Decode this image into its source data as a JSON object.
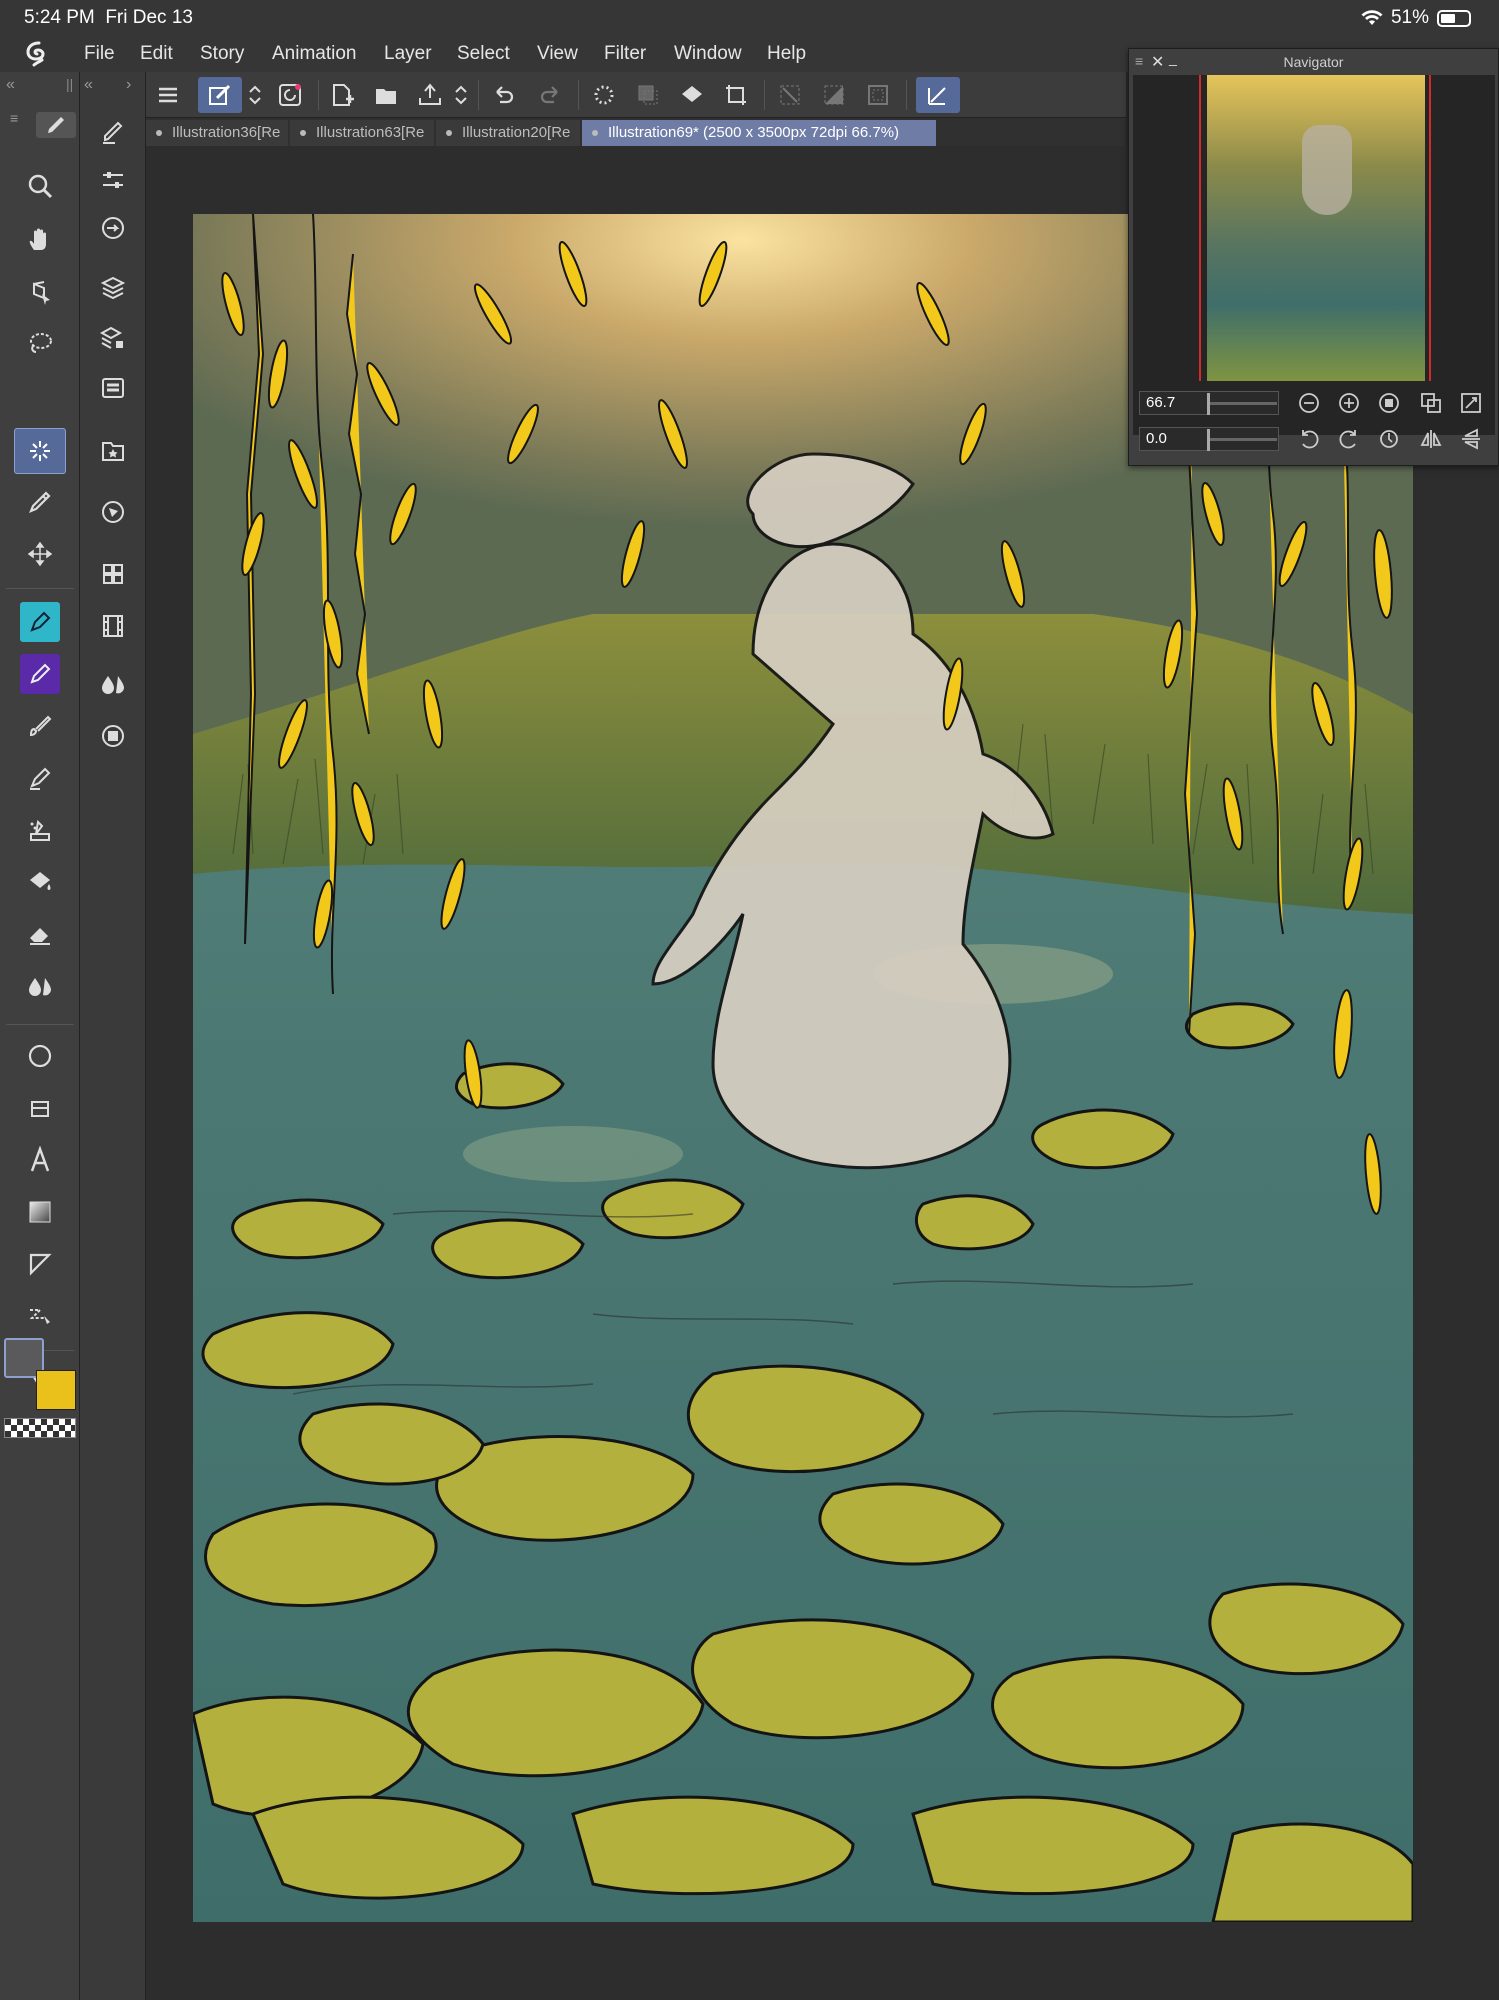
{
  "status": {
    "time": "5:24 PM",
    "date": "Fri Dec 13",
    "battery": "51%"
  },
  "menu": [
    "File",
    "Edit",
    "Story",
    "Animation",
    "Layer",
    "Select",
    "View",
    "Filter",
    "Window",
    "Help"
  ],
  "tabs": [
    {
      "label": "Illustration36[Re"
    },
    {
      "label": "Illustration63[Re"
    },
    {
      "label": "Illustration20[Re"
    },
    {
      "label": "Illustration69* (2500 x 3500px 72dpi 66.7%)"
    }
  ],
  "navigator": {
    "title": "Navigator",
    "zoom": "66.7",
    "rotation": "0.0"
  },
  "colors": {
    "main": "#5a5a5c",
    "sub": "#e9c11a",
    "active_tool": "#566a9a"
  },
  "icons": {
    "left_palette": [
      "zoom-icon",
      "hand-icon",
      "operation-icon",
      "lasso-select-icon",
      "auto-select-icon",
      "eyedropper-icon",
      "move-icon",
      "pen-icon",
      "pencil-icon",
      "brush-icon",
      "airbrush-icon",
      "decoration-icon",
      "fill-icon",
      "eraser-icon",
      "blend-icon",
      "figure-icon",
      "frame-icon",
      "text-icon",
      "gradient-icon",
      "ruler-icon",
      "correct-line-icon",
      "object-icon"
    ],
    "sub_palette": [
      "sub-tool-icon",
      "tool-property-icon",
      "brush-size-icon",
      "layer-icon",
      "layer-property-icon",
      "layer-search-icon",
      "material-icon",
      "navigator-icon",
      "item-bank-icon",
      "animation-timeline-icon",
      "color-circle-icon",
      "color-history-icon"
    ]
  }
}
